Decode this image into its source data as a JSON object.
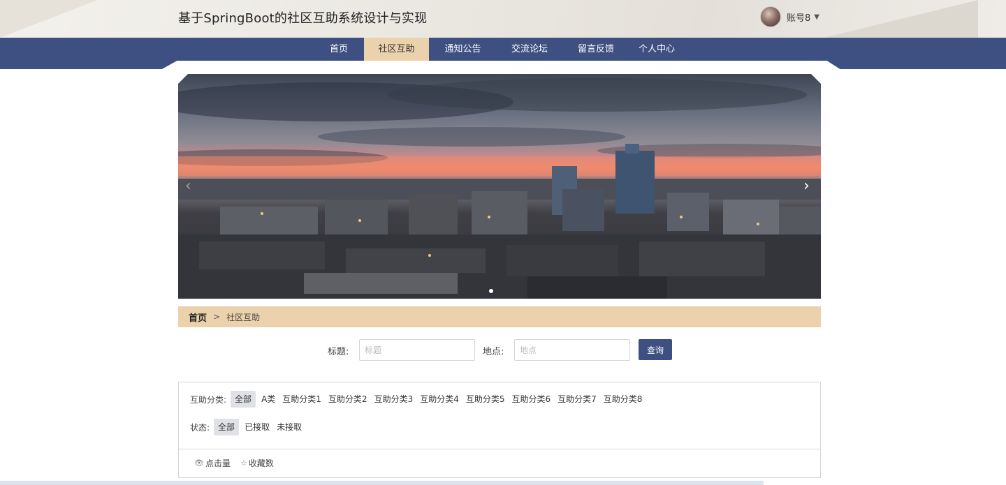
{
  "header": {
    "site_title": "基于SpringBoot的社区互助系统设计与实现",
    "username": "账号8",
    "caret": "▼"
  },
  "nav": {
    "items": [
      {
        "label": "首页",
        "active": false
      },
      {
        "label": "社区互助",
        "active": true
      },
      {
        "label": "通知公告",
        "active": false
      },
      {
        "label": "交流论坛",
        "active": false
      },
      {
        "label": "留言反馈",
        "active": false
      },
      {
        "label": "个人中心",
        "active": false
      }
    ]
  },
  "banner": {
    "prev_arrow": "‹",
    "next_arrow": "›"
  },
  "breadcrumb": {
    "home": "首页",
    "separator": ">",
    "current": "社区互助"
  },
  "search": {
    "title_label": "标题:",
    "title_placeholder": "标题",
    "location_label": "地点:",
    "location_placeholder": "地点",
    "button": "查询"
  },
  "filters": {
    "category_label": "互助分类:",
    "categories": [
      "全部",
      "A类",
      "互助分类1",
      "互助分类2",
      "互助分类3",
      "互助分类4",
      "互助分类5",
      "互助分类6",
      "互助分类7",
      "互助分类8"
    ],
    "category_selected": "全部",
    "status_label": "状态:",
    "statuses": [
      "全部",
      "已接取",
      "未接取"
    ],
    "status_selected": "全部"
  },
  "sort": {
    "clicks_label": "点击量",
    "favorites_label": "收藏数"
  },
  "colors": {
    "nav_bg": "#3e5082",
    "accent_beige": "#ecd2ac",
    "button_bg": "#3e5082"
  }
}
